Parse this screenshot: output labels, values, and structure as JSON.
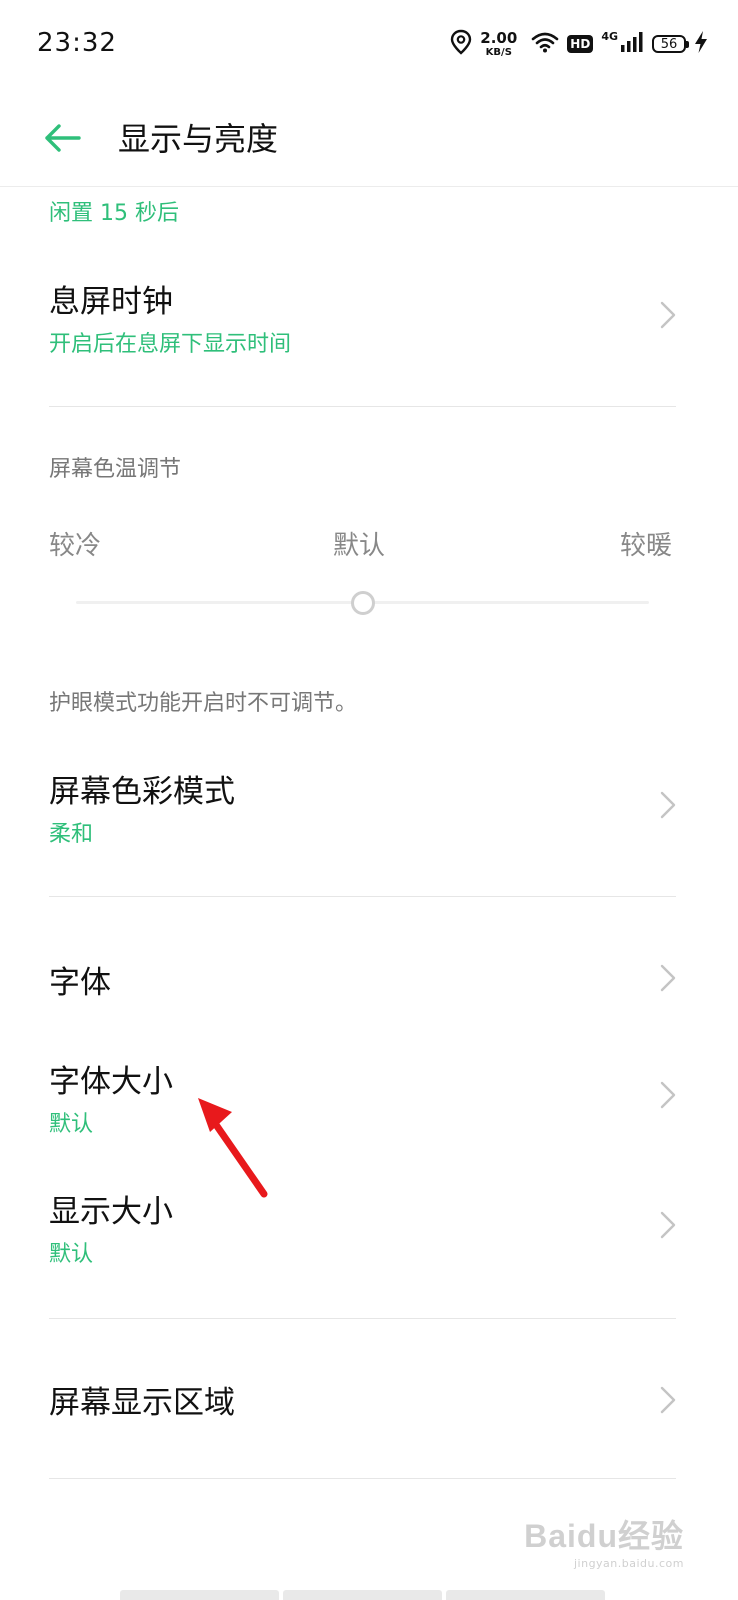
{
  "status_bar": {
    "time": "23:32",
    "speed_value": "2.00",
    "speed_unit": "KB/S",
    "hd": "HD",
    "network": "4G",
    "battery": "56",
    "icons": [
      "location-icon",
      "wifi-icon",
      "hd-icon",
      "signal-icon",
      "battery-icon",
      "charging-icon"
    ]
  },
  "header": {
    "title": "显示与亮度",
    "back_icon": "back-arrow-icon"
  },
  "settings": {
    "idle_value": "闲置 15 秒后",
    "aod": {
      "title": "息屏时钟",
      "subtitle": "开启后在息屏下显示时间"
    },
    "color_temp": {
      "section_label": "屏幕色温调节",
      "left_label": "较冷",
      "center_label": "默认",
      "right_label": "较暖",
      "slider_value": 0.5,
      "note": "护眼模式功能开启时不可调节。"
    },
    "color_mode": {
      "title": "屏幕色彩模式",
      "value": "柔和"
    },
    "font": {
      "title": "字体"
    },
    "font_size": {
      "title": "字体大小",
      "value": "默认"
    },
    "display_size": {
      "title": "显示大小",
      "value": "默认"
    },
    "screen_area": {
      "title": "屏幕显示区域"
    }
  },
  "watermark": {
    "logo": "Baidu经验",
    "url": "jingyan.baidu.com"
  },
  "colors": {
    "accent": "#2fbf7a",
    "annotation": "#e8191c",
    "divider": "#e6e6e6"
  }
}
